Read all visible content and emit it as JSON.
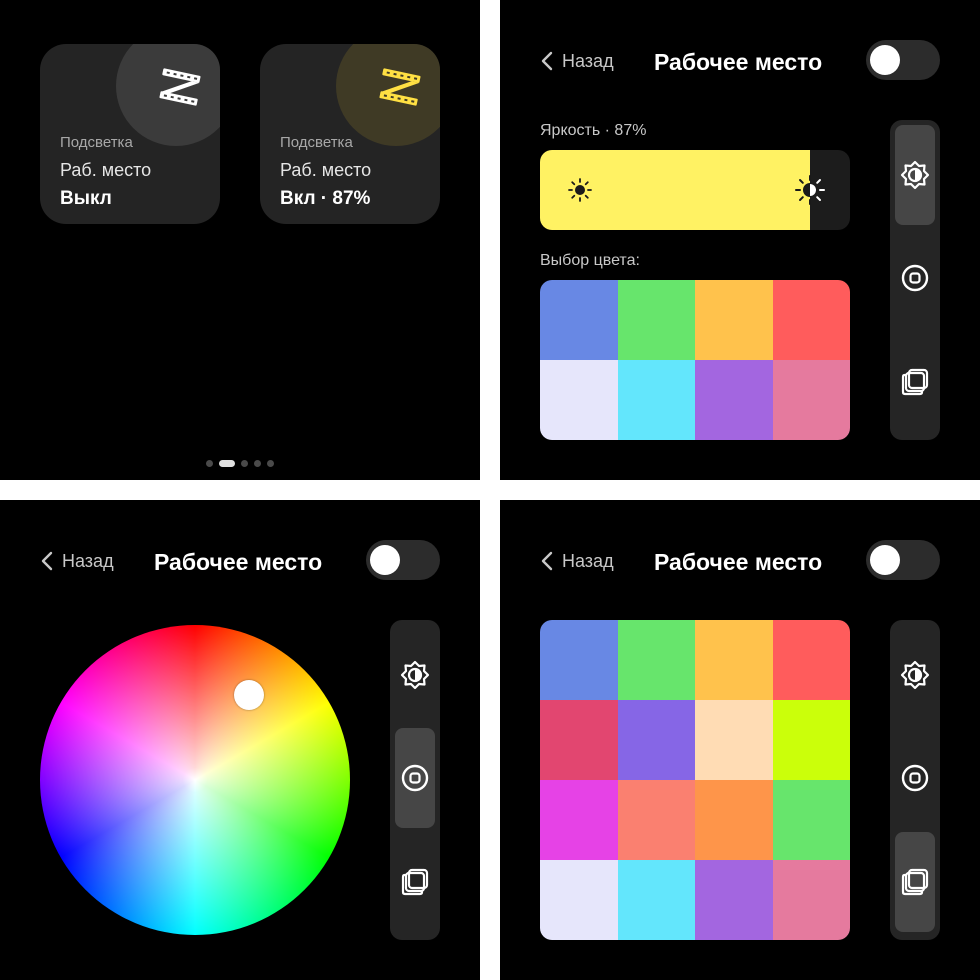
{
  "panel1": {
    "tiles": [
      {
        "category": "Подсветка",
        "name": "Раб. место",
        "state": "Выкл",
        "blob_color": "#3b3b3b",
        "icon_color": "#ffffff",
        "icon": "led-strip-icon"
      },
      {
        "category": "Подсветка",
        "name": "Раб. место",
        "state": "Вкл · 87%",
        "blob_color": "#3f3a25",
        "icon_color": "#ffe043",
        "icon": "led-strip-icon"
      }
    ],
    "page_indicator": {
      "pages": 5,
      "active": 2
    }
  },
  "header": {
    "back_label": "Назад",
    "title": "Рабочее место",
    "toggle_on": false
  },
  "panel2": {
    "brightness_label": "Яркость · 87%",
    "brightness": 0.87,
    "brightness_color": "#fff263",
    "color_label": "Выбор цвета:",
    "swatches": [
      "#6888e4",
      "#67e56c",
      "#ffc24c",
      "#ff5c5c",
      "#e6e6fb",
      "#63e6fc",
      "#a366e0",
      "#e57a9e"
    ],
    "selected_rail": "brightness"
  },
  "panel3": {
    "selected_rail": "wheel"
  },
  "panel4": {
    "swatches": [
      "#6888e4",
      "#67e56c",
      "#ffc24c",
      "#ff5c5c",
      "#e24670",
      "#8666e6",
      "#ffdcb4",
      "#cbff0a",
      "#e642e6",
      "#fa8070",
      "#fe954a",
      "#67e56c",
      "#e6e6fb",
      "#63e6fc",
      "#a366e0",
      "#e57a9e"
    ],
    "selected_rail": "presets"
  },
  "rail_icons": [
    "brightness-icon",
    "color-wheel-icon",
    "presets-icon"
  ]
}
